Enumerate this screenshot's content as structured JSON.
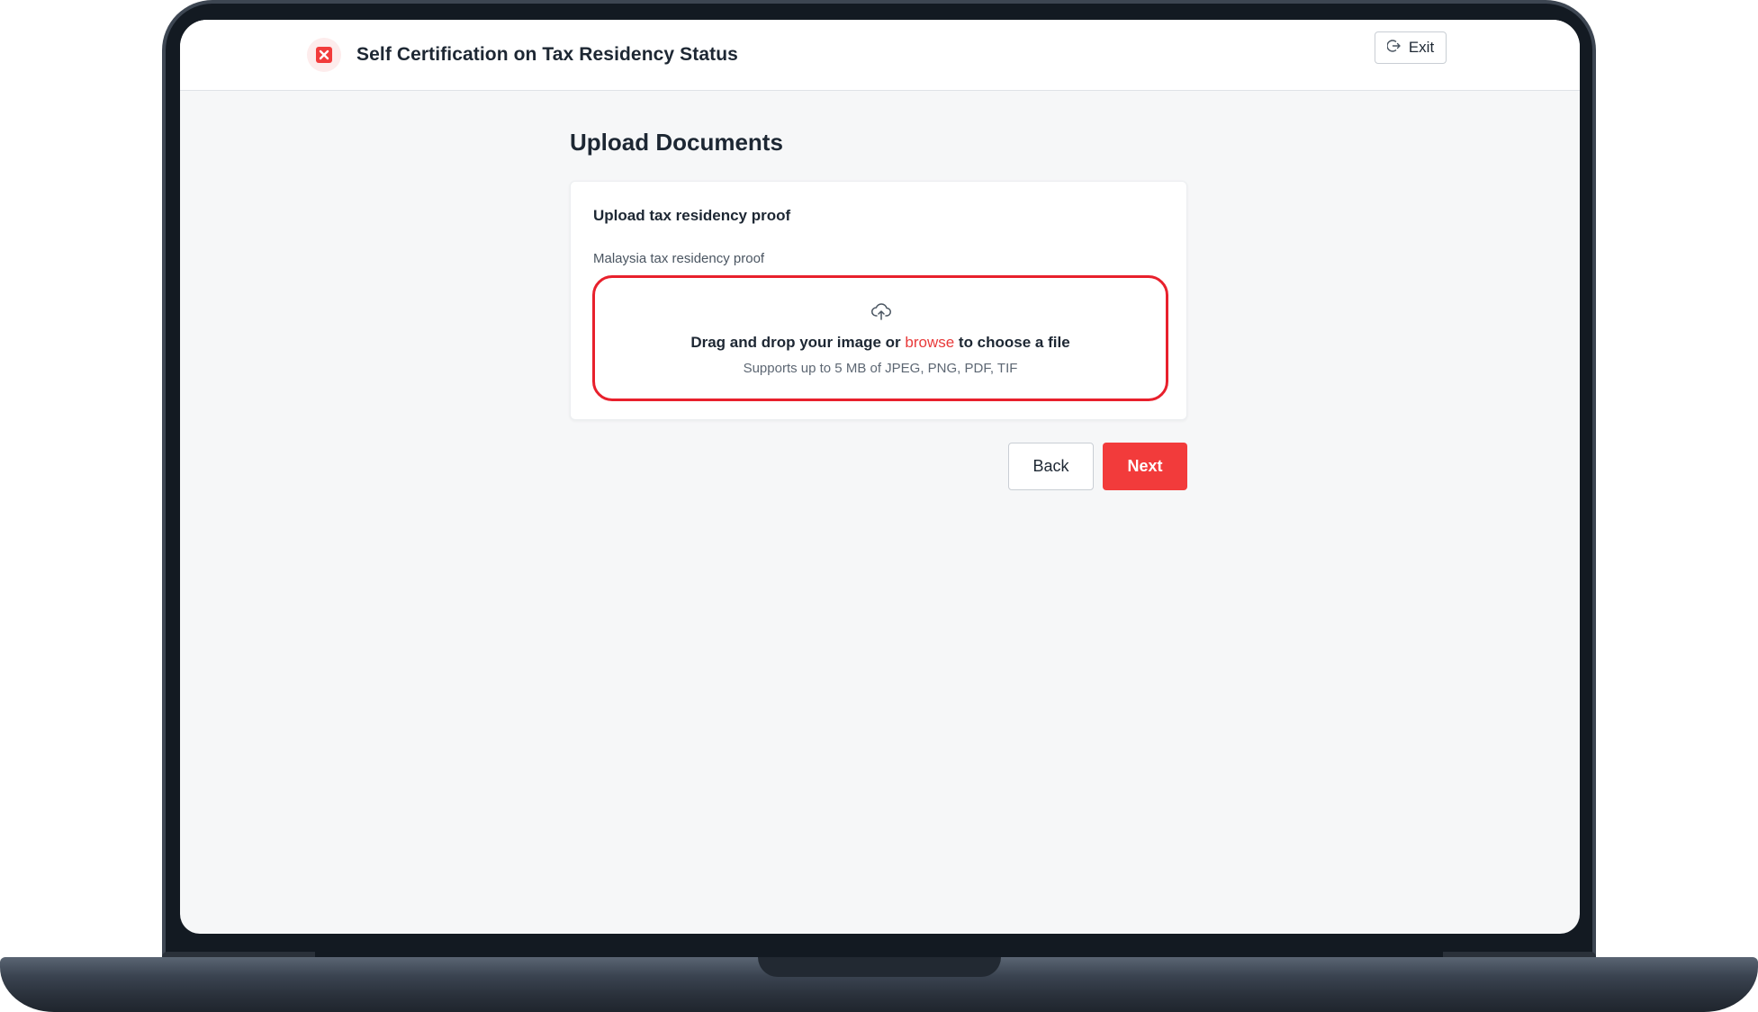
{
  "app": {
    "title": "Self Certification on Tax Residency Status",
    "logo_icon": "x-badge-icon",
    "exit_label": "Exit",
    "exit_icon": "logout-icon"
  },
  "page": {
    "title": "Upload Documents"
  },
  "upload_card": {
    "title": "Upload tax residency proof",
    "field_label": "Malaysia tax residency proof",
    "dropzone": {
      "icon": "cloud-upload-icon",
      "text_before": "Drag and drop your image or ",
      "browse_label": "browse",
      "text_after": " to choose a file",
      "supports": "Supports up to 5 MB of JPEG, PNG, PDF, TIF"
    }
  },
  "actions": {
    "back_label": "Back",
    "next_label": "Next"
  },
  "colors": {
    "accent": "#f23b3b",
    "highlight_border": "#e8202c",
    "text": "#1d2733"
  }
}
